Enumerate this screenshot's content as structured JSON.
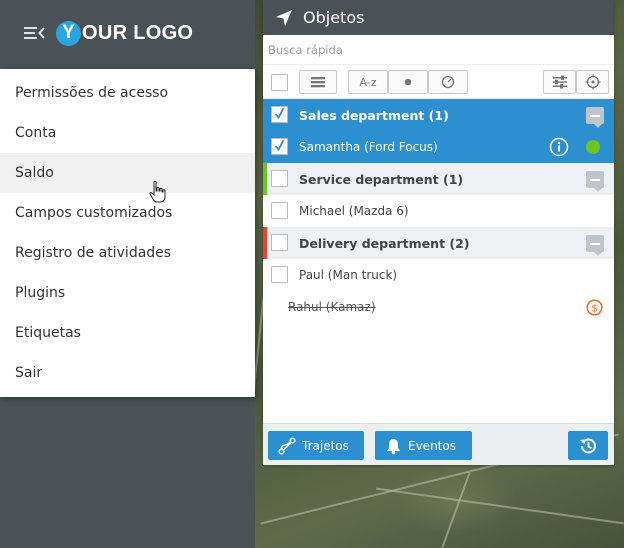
{
  "logo": {
    "mark": "Y",
    "text": "OUR LOGO"
  },
  "menu": {
    "items": [
      {
        "label": "Permissões de acesso"
      },
      {
        "label": "Conta"
      },
      {
        "label": "Saldo"
      },
      {
        "label": "Campos customizados"
      },
      {
        "label": "Registro de atividades"
      },
      {
        "label": "Plugins"
      },
      {
        "label": "Etiquetas"
      },
      {
        "label": "Sair"
      }
    ]
  },
  "objects": {
    "title": "Objetos",
    "search_placeholder": "Busca rápida",
    "toolbar": {
      "sort_label": "A-z"
    },
    "groups": [
      {
        "name": "Sales department (1)",
        "selected": true,
        "color": "#2b8fd0",
        "items": [
          {
            "name": "Samantha (Ford Focus)",
            "selected": true,
            "status_color": "#6bc623"
          }
        ]
      },
      {
        "name": "Service department (1)",
        "selected": false,
        "color": "#6bc623",
        "items": [
          {
            "name": "Michael (Mazda 6)",
            "selected": false
          }
        ]
      },
      {
        "name": "Delivery department (2)",
        "selected": false,
        "color": "#e8412c",
        "items": [
          {
            "name": "Paul (Man truck)",
            "selected": false
          },
          {
            "name": "Rahul (Kamaz)",
            "selected": false,
            "strikethrough": true
          }
        ]
      }
    ],
    "footer": {
      "tracks_label": "Trajetos",
      "events_label": "Eventos"
    }
  },
  "colors": {
    "primary": "#2b8fd0",
    "header_bg": "#4a5257",
    "ok": "#6bc623",
    "alert": "#e8692c"
  }
}
